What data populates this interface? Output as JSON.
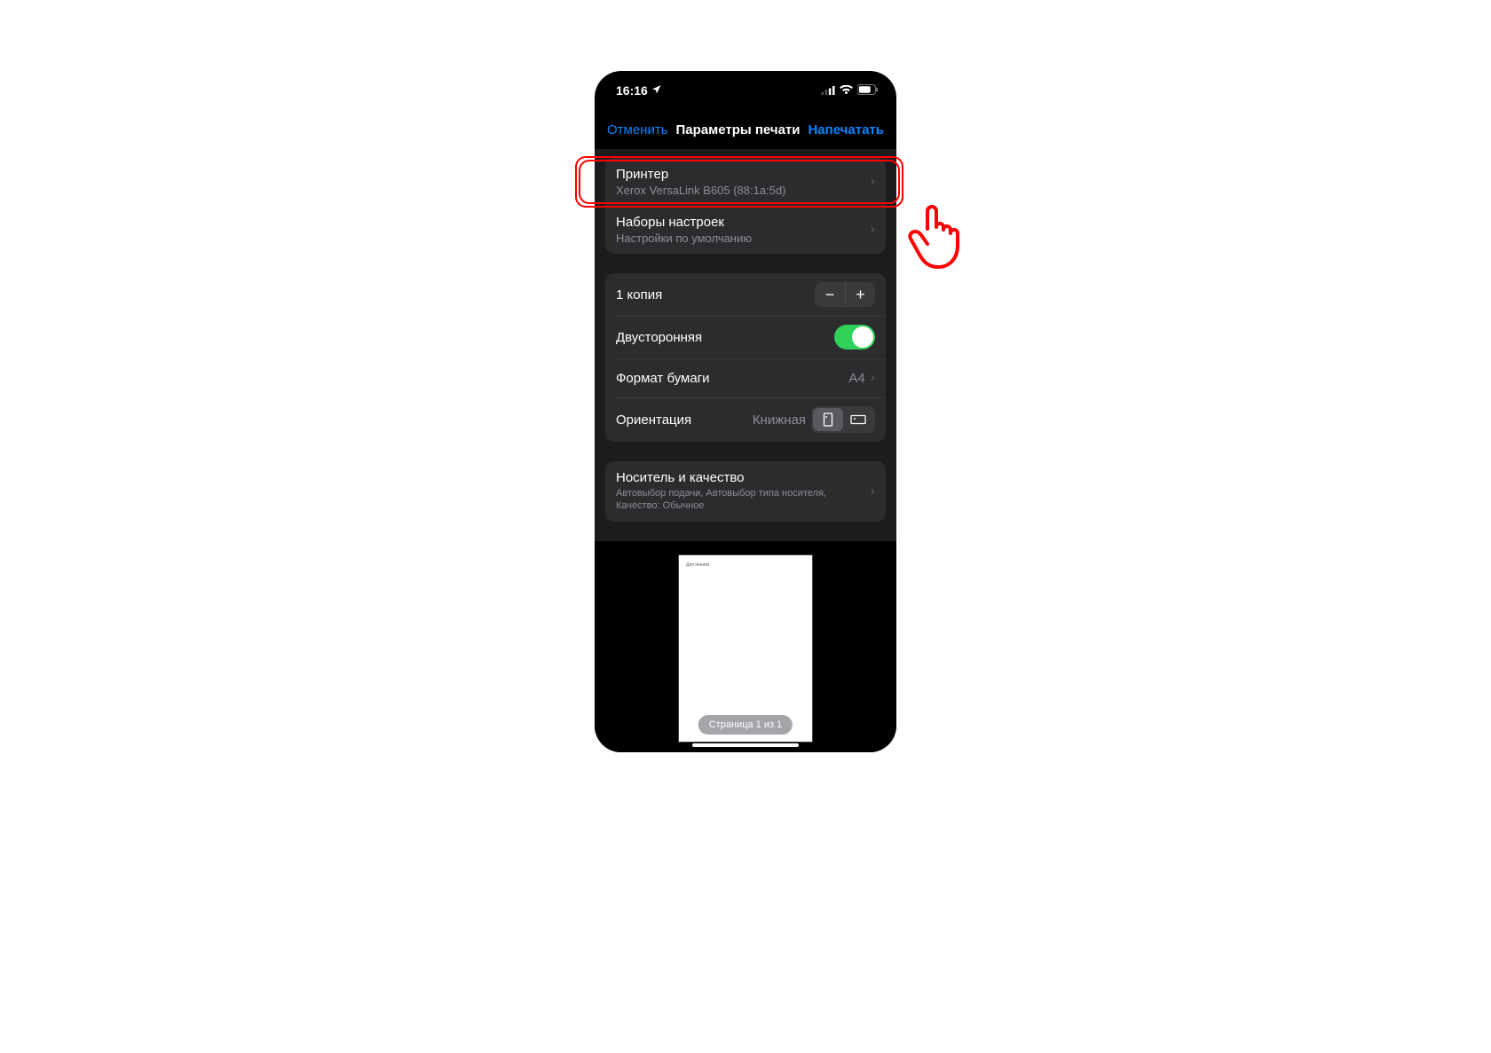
{
  "status": {
    "time": "16:16"
  },
  "nav": {
    "cancel": "Отменить",
    "title": "Параметры печати",
    "print": "Напечатать"
  },
  "printer": {
    "label": "Принтер",
    "value": "Xerox VersaLink B605 (88:1a:5d)"
  },
  "presets": {
    "label": "Наборы настроек",
    "value": "Настройки по умолчанию"
  },
  "copies": {
    "label": "1 копия"
  },
  "duplex": {
    "label": "Двусторонняя",
    "on": true
  },
  "paper": {
    "label": "Формат бумаги",
    "value": "A4"
  },
  "orientation": {
    "label": "Ориентация",
    "value": "Книжная"
  },
  "media": {
    "label": "Носитель и качество",
    "value": "Автовыбор подачи, Автовыбор типа носителя, Качество: Обычное"
  },
  "preview": {
    "doc_text": "Для печати",
    "badge": "Страница 1 из 1"
  }
}
